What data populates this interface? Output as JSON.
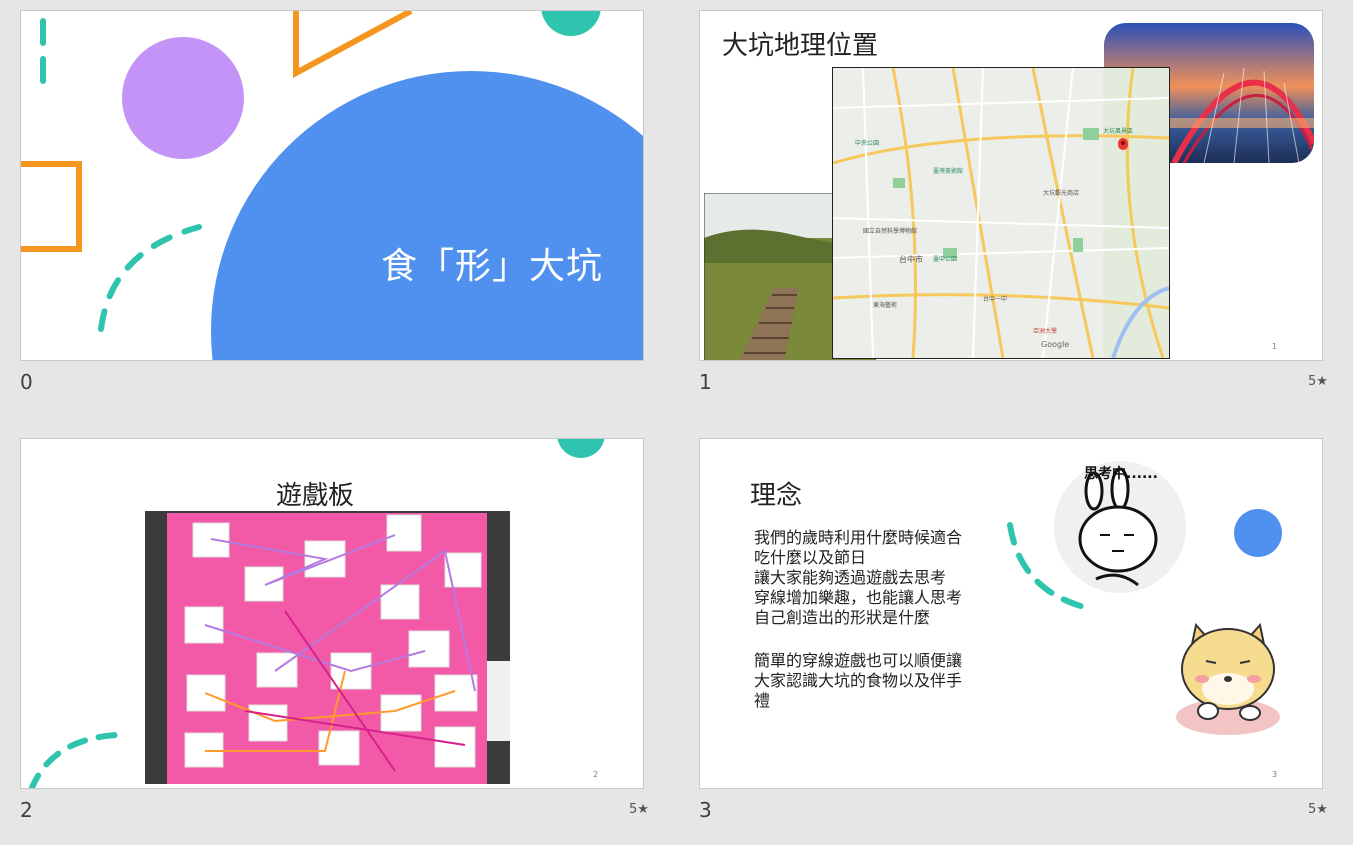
{
  "slides": [
    {
      "number": "0",
      "title": "食「形」大坑",
      "has_star": false
    },
    {
      "number": "1",
      "title": "大坑地理位置",
      "page_number": "1",
      "map": {
        "city_label": "台中市",
        "brand": "Google",
        "places": [
          "中央公園",
          "大坑風景區",
          "臺灣美術館",
          "國立自然科學博物館",
          "臺中公園",
          "東海藝術",
          "台中一中",
          "大坑觀光商店",
          "亞洲大學"
        ]
      },
      "has_star": true
    },
    {
      "number": "2",
      "title": "遊戲板",
      "page_number": "2",
      "has_star": true
    },
    {
      "number": "3",
      "title": "理念",
      "page_number": "3",
      "paragraph_1": "我們的歲時利用什麼時候適合\n吃什麼以及節日\n讓大家能夠透過遊戲去思考\n穿線增加樂趣，也能讓人思考\n自己創造出的形狀是什麼",
      "paragraph_2": "簡單的穿線遊戲也可以順便讓\n大家認識大坑的食物以及伴手\n禮",
      "sticker_text": "思考中......",
      "has_star": true
    }
  ],
  "star_glyph": "5★",
  "colors": {
    "blue": "#5090ee",
    "teal": "#2ec4ad",
    "orange": "#f5961e",
    "purple": "#c393f7",
    "pink": "#f25aa8"
  }
}
